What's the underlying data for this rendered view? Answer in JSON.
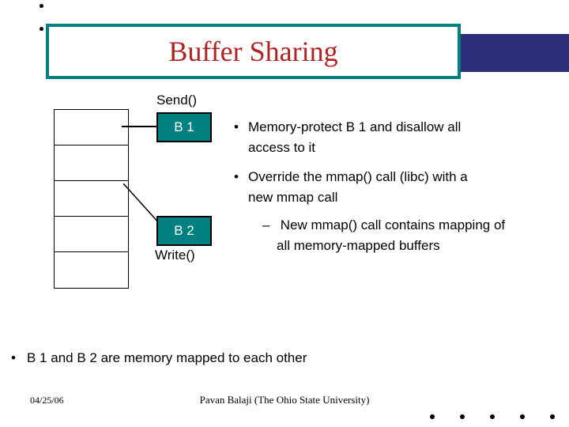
{
  "title": "Buffer Sharing",
  "diagram": {
    "send_label": "Send()",
    "write_label": "Write()",
    "b1_label": "B 1",
    "b2_label": "B 2"
  },
  "bullets": {
    "items": [
      {
        "text_1": "Memory-protect B 1 and disallow all",
        "text_2": "access to it"
      },
      {
        "text_1": "Override the mmap() call (libc) with a",
        "text_2": "new mmap call",
        "sub_1": "New mmap() call contains mapping of",
        "sub_2": "all memory-mapped buffers"
      }
    ]
  },
  "lower_bullet": "B 1 and B 2 are memory mapped to each other",
  "footer": {
    "date": "04/25/06",
    "author": "Pavan Balaji (The Ohio State University)"
  }
}
